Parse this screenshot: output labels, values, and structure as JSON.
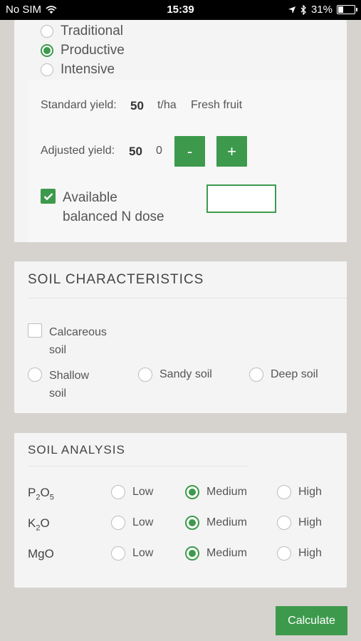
{
  "status_bar": {
    "carrier": "No SIM",
    "time": "15:39",
    "battery": "31%",
    "battery_level": 0.31
  },
  "system": {
    "options": [
      {
        "label": "Traditional",
        "selected": false
      },
      {
        "label": "Productive",
        "selected": true
      },
      {
        "label": "Intensive",
        "selected": false
      }
    ]
  },
  "yield": {
    "standard_label": "Standard yield:",
    "standard_value": "50",
    "unit": "t/ha",
    "product": "Fresh fruit",
    "adjusted_label": "Adjusted yield:",
    "adjusted_value": "50",
    "adjusted_delta": "0",
    "minus": "-",
    "plus": "+",
    "n_dose_line1": "Available",
    "n_dose_line2": "balanced N dose",
    "n_dose_checked": true,
    "n_dose_value": ""
  },
  "soil_characteristics": {
    "title": "SOIL CHARACTERISTICS",
    "calcareous_line1": "Calcareous",
    "calcareous_line2": "soil",
    "shallow_line1": "Shallow",
    "shallow_line2": "soil",
    "sandy": "Sandy soil",
    "deep": "Deep soil"
  },
  "soil_analysis": {
    "title": "SOIL ANALYSIS",
    "levels": [
      "Low",
      "Medium",
      "High"
    ],
    "rows": [
      {
        "name": "P2O5",
        "name_main": "P",
        "sub1": "2",
        "mid": "O",
        "sub2": "5",
        "selected": "Medium"
      },
      {
        "name": "K2O",
        "name_main": "K",
        "sub1": "2",
        "mid": "O",
        "sub2": "",
        "selected": "Medium"
      },
      {
        "name": "MgO",
        "name_main": "MgO",
        "sub1": "",
        "mid": "",
        "sub2": "",
        "selected": "Medium"
      }
    ]
  },
  "actions": {
    "calculate": "Calculate"
  },
  "colors": {
    "accent": "#3d9a4c",
    "background": "#d6d3cf",
    "card": "#f4f4f4"
  }
}
